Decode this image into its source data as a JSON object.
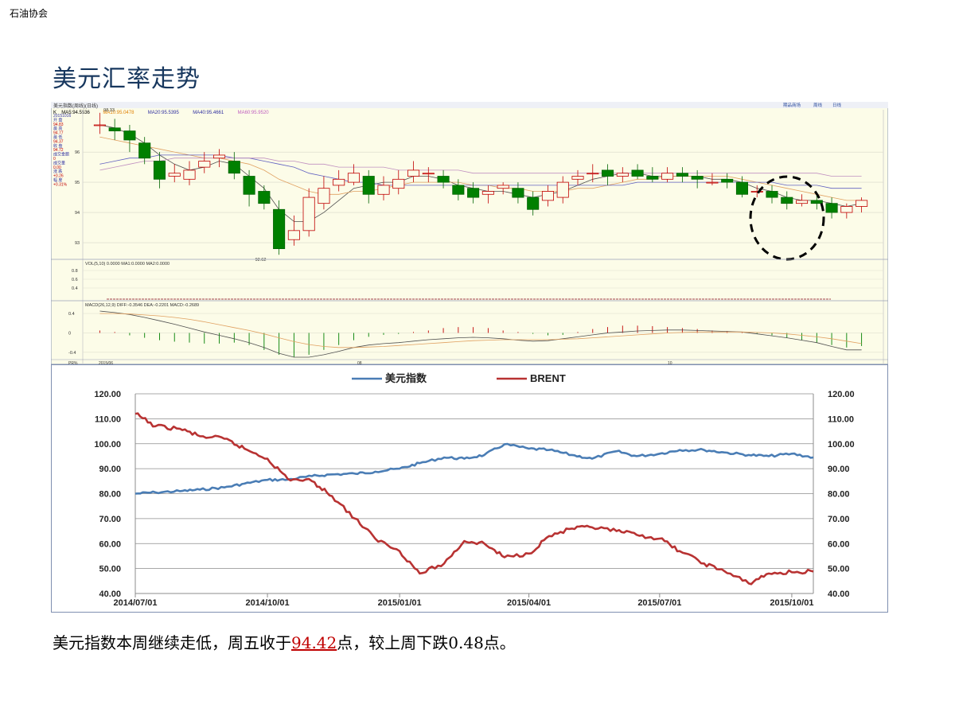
{
  "header": {
    "org": "石油协会"
  },
  "slide": {
    "title": "美元汇率走势",
    "summary_prefix": "美元指数本周继续走低，周五收于",
    "summary_value": "94.42",
    "summary_suffix": "点，较上周下跌0.48点。"
  },
  "kline": {
    "header_text": "美元指数(周线)(日线)",
    "ma_labels": [
      {
        "text": "K",
        "color": "#000000"
      },
      {
        "text": "MA5:94.5536",
        "color": "#000000"
      },
      {
        "text": "MA10:95.0478",
        "color": "#e08000"
      },
      {
        "text": "MA20:95.5395",
        "color": "#3030a0"
      },
      {
        "text": "MA40:95.4661",
        "color": "#3030a0"
      },
      {
        "text": "MA60:95.9520",
        "color": "#c060c0"
      }
    ],
    "top_right_buttons": [
      "期品商场",
      "周线",
      "日线"
    ],
    "sidebar": [
      "20151016",
      "开 盘",
      "94.83",
      "最 高",
      "94.77",
      "最 低",
      "94.37",
      "收 盘",
      "94.72",
      "成交金额",
      "0",
      "成交量",
      "0.00",
      "涨 跌",
      "+0.26",
      "幅 度",
      "+0.31%"
    ],
    "ylabels": [
      "96",
      "95",
      "94",
      "93"
    ],
    "high_label": "98.33",
    "low_label": "92.62",
    "vol_header": "VOL(5,10) 0.0000 MA1:0.0000 MA2:0.0000",
    "vol_ylabels": [
      "0.8",
      "0.6",
      "0.4"
    ],
    "macd_header": "MACD(26,12,9) DIFF:-0.3546 DEA:-0.2201 MACD:-0.2689",
    "macd_ylabels": [
      "0.4",
      "0",
      "-0.4"
    ],
    "bottom_labels": [
      "PR%",
      "2015/06",
      "08",
      "10"
    ],
    "candles": [
      [
        96.9,
        96.9,
        97.3,
        96.6
      ],
      [
        96.8,
        96.7,
        97.1,
        96.4
      ],
      [
        96.7,
        96.4,
        96.9,
        96.0
      ],
      [
        96.3,
        95.8,
        96.5,
        95.6
      ],
      [
        95.7,
        95.1,
        96.0,
        94.8
      ],
      [
        95.2,
        95.3,
        95.6,
        95.0
      ],
      [
        95.1,
        95.4,
        95.7,
        94.9
      ],
      [
        95.5,
        95.7,
        96.0,
        95.3
      ],
      [
        95.8,
        95.9,
        96.1,
        95.5
      ],
      [
        95.7,
        95.3,
        96.0,
        95.1
      ],
      [
        95.2,
        94.6,
        95.4,
        94.2
      ],
      [
        94.7,
        94.3,
        94.9,
        94.1
      ],
      [
        94.1,
        92.8,
        94.4,
        92.6
      ],
      [
        93.1,
        93.4,
        93.9,
        92.9
      ],
      [
        93.4,
        94.5,
        94.8,
        93.2
      ],
      [
        94.3,
        94.8,
        95.2,
        94.1
      ],
      [
        94.9,
        95.1,
        95.4,
        94.7
      ],
      [
        95.0,
        95.3,
        95.6,
        94.9
      ],
      [
        95.2,
        94.6,
        95.4,
        94.3
      ],
      [
        94.6,
        94.9,
        95.2,
        94.4
      ],
      [
        94.8,
        95.1,
        95.4,
        94.6
      ],
      [
        95.2,
        95.4,
        95.7,
        95.0
      ],
      [
        95.3,
        95.3,
        95.5,
        95.0
      ],
      [
        95.2,
        95.0,
        95.4,
        94.8
      ],
      [
        94.9,
        94.6,
        95.1,
        94.4
      ],
      [
        94.8,
        94.5,
        95.0,
        94.3
      ],
      [
        94.6,
        94.7,
        94.9,
        94.3
      ],
      [
        94.8,
        94.9,
        95.0,
        94.6
      ],
      [
        94.8,
        94.5,
        95.0,
        94.3
      ],
      [
        94.5,
        94.1,
        94.7,
        93.9
      ],
      [
        94.4,
        94.7,
        94.9,
        94.2
      ],
      [
        94.5,
        95.0,
        95.2,
        94.3
      ],
      [
        95.1,
        95.2,
        95.4,
        94.9
      ],
      [
        95.3,
        95.3,
        95.6,
        95.0
      ],
      [
        95.4,
        95.2,
        95.6,
        94.9
      ],
      [
        95.2,
        95.3,
        95.5,
        95.0
      ],
      [
        95.4,
        95.2,
        95.6,
        95.1
      ],
      [
        95.2,
        95.1,
        95.5,
        95.0
      ],
      [
        95.1,
        95.3,
        95.5,
        95.0
      ],
      [
        95.3,
        95.2,
        95.5,
        95.0
      ],
      [
        95.2,
        95.1,
        95.4,
        94.8
      ],
      [
        95.0,
        95.0,
        95.3,
        94.9
      ],
      [
        95.1,
        95.0,
        95.3,
        94.8
      ],
      [
        95.0,
        94.6,
        95.2,
        94.5
      ],
      [
        94.7,
        94.7,
        94.9,
        94.5
      ],
      [
        94.7,
        94.5,
        94.9,
        94.3
      ],
      [
        94.5,
        94.3,
        94.7,
        94.1
      ],
      [
        94.3,
        94.4,
        94.6,
        94.2
      ],
      [
        94.4,
        94.3,
        94.6,
        94.1
      ],
      [
        94.3,
        94.0,
        94.5,
        93.8
      ],
      [
        94.0,
        94.2,
        94.3,
        93.8
      ],
      [
        94.2,
        94.4,
        94.5,
        94.0
      ]
    ],
    "ma_lines": {
      "ma5": [
        96.9,
        96.8,
        96.6,
        96.3,
        95.9,
        95.6,
        95.4,
        95.5,
        95.7,
        95.6,
        95.2,
        94.8,
        94.1,
        93.7,
        93.7,
        94.0,
        94.4,
        94.8,
        94.9,
        95.0,
        95.0,
        95.2,
        95.2,
        95.1,
        94.9,
        94.8,
        94.7,
        94.7,
        94.6,
        94.5,
        94.6,
        94.7,
        94.9,
        95.1,
        95.2,
        95.3,
        95.3,
        95.2,
        95.2,
        95.2,
        95.2,
        95.1,
        95.1,
        95.0,
        94.8,
        94.7,
        94.5,
        94.4,
        94.4,
        94.3,
        94.2,
        94.3
      ],
      "ma10": [
        96.5,
        96.4,
        96.3,
        96.2,
        96.1,
        96.0,
        95.9,
        95.8,
        95.8,
        95.7,
        95.6,
        95.4,
        95.1,
        94.9,
        94.7,
        94.6,
        94.6,
        94.7,
        94.7,
        94.8,
        94.9,
        95.0,
        95.0,
        95.0,
        95.0,
        94.9,
        94.9,
        94.8,
        94.8,
        94.7,
        94.7,
        94.7,
        94.8,
        94.8,
        94.9,
        95.0,
        95.1,
        95.1,
        95.2,
        95.2,
        95.2,
        95.2,
        95.2,
        95.1,
        95.0,
        94.9,
        94.8,
        94.7,
        94.6,
        94.5,
        94.4,
        94.4
      ],
      "ma20": [
        95.6,
        95.7,
        95.8,
        95.8,
        95.9,
        95.9,
        95.9,
        95.9,
        95.9,
        95.8,
        95.8,
        95.7,
        95.6,
        95.5,
        95.3,
        95.2,
        95.1,
        95.0,
        95.0,
        94.9,
        94.9,
        94.9,
        94.9,
        94.9,
        94.9,
        94.9,
        94.9,
        94.9,
        94.9,
        94.9,
        94.9,
        94.9,
        94.9,
        94.9,
        94.9,
        94.9,
        95.0,
        95.0,
        95.0,
        95.0,
        95.0,
        95.0,
        95.0,
        95.0,
        95.0,
        95.0,
        94.9,
        94.9,
        94.9,
        94.8,
        94.8,
        94.8
      ],
      "ma60": [
        95.4,
        95.5,
        95.6,
        95.7,
        95.7,
        95.8,
        95.8,
        95.8,
        95.8,
        95.8,
        95.8,
        95.8,
        95.7,
        95.7,
        95.6,
        95.6,
        95.5,
        95.5,
        95.5,
        95.5,
        95.4,
        95.4,
        95.4,
        95.4,
        95.4,
        95.3,
        95.3,
        95.3,
        95.3,
        95.3,
        95.3,
        95.3,
        95.3,
        95.3,
        95.3,
        95.3,
        95.3,
        95.3,
        95.3,
        95.3,
        95.3,
        95.3,
        95.3,
        95.3,
        95.3,
        95.3,
        95.3,
        95.3,
        95.3,
        95.2,
        95.2,
        95.2
      ]
    },
    "macd_bars": [
      0.05,
      0.02,
      -0.05,
      -0.1,
      -0.15,
      -0.18,
      -0.2,
      -0.22,
      -0.22,
      -0.2,
      -0.25,
      -0.35,
      -0.45,
      -0.5,
      -0.45,
      -0.35,
      -0.25,
      -0.15,
      -0.08,
      -0.04,
      -0.02,
      0.02,
      0.05,
      0.1,
      0.12,
      0.12,
      0.1,
      0.05,
      0.02,
      -0.02,
      -0.05,
      -0.04,
      0.02,
      0.08,
      0.12,
      0.15,
      0.15,
      0.14,
      0.12,
      0.1,
      0.08,
      0.05,
      0.04,
      0.02,
      -0.02,
      -0.05,
      -0.1,
      -0.15,
      -0.2,
      -0.25,
      -0.3,
      -0.27
    ],
    "diff": [
      0.45,
      0.42,
      0.38,
      0.32,
      0.25,
      0.18,
      0.1,
      0.02,
      -0.05,
      -0.12,
      -0.2,
      -0.3,
      -0.42,
      -0.5,
      -0.5,
      -0.45,
      -0.38,
      -0.3,
      -0.25,
      -0.22,
      -0.2,
      -0.17,
      -0.14,
      -0.12,
      -0.1,
      -0.09,
      -0.1,
      -0.12,
      -0.15,
      -0.17,
      -0.16,
      -0.12,
      -0.08,
      -0.04,
      0.0,
      0.02,
      0.04,
      0.05,
      0.06,
      0.06,
      0.05,
      0.04,
      0.03,
      0.02,
      -0.02,
      -0.06,
      -0.1,
      -0.15,
      -0.2,
      -0.28,
      -0.35,
      -0.35
    ],
    "dea": [
      0.4,
      0.4,
      0.39,
      0.37,
      0.35,
      0.32,
      0.28,
      0.23,
      0.17,
      0.11,
      0.05,
      -0.02,
      -0.1,
      -0.18,
      -0.24,
      -0.28,
      -0.3,
      -0.3,
      -0.29,
      -0.28,
      -0.26,
      -0.24,
      -0.22,
      -0.2,
      -0.18,
      -0.16,
      -0.15,
      -0.14,
      -0.14,
      -0.14,
      -0.14,
      -0.13,
      -0.12,
      -0.1,
      -0.08,
      -0.06,
      -0.04,
      -0.02,
      0.0,
      0.01,
      0.02,
      0.02,
      0.02,
      0.02,
      0.01,
      0.0,
      -0.02,
      -0.05,
      -0.08,
      -0.12,
      -0.17,
      -0.22
    ],
    "circle_label": ""
  },
  "chart_data": {
    "type": "line",
    "title": "",
    "legend": [
      "美元指数",
      "BRENT"
    ],
    "legend_position": "top",
    "xlabel": "",
    "ylabel": "",
    "ylim": [
      40,
      120
    ],
    "yticks": [
      "40.00",
      "50.00",
      "60.00",
      "70.00",
      "80.00",
      "90.00",
      "100.00",
      "110.00",
      "120.00"
    ],
    "xticks": [
      "2014/07/01",
      "2014/10/01",
      "2015/01/01",
      "2015/04/01",
      "2015/07/01",
      "2015/10/01"
    ],
    "x_range": [
      "2014/07/01",
      "2015/10/16"
    ],
    "grid": true,
    "series": [
      {
        "name": "美元指数",
        "color": "#4a7db5",
        "points": [
          [
            "2014/07/01",
            80.0
          ],
          [
            "2014/07/15",
            80.5
          ],
          [
            "2014/08/01",
            81.0
          ],
          [
            "2014/08/15",
            81.6
          ],
          [
            "2014/09/01",
            82.5
          ],
          [
            "2014/09/15",
            84.0
          ],
          [
            "2014/10/01",
            85.5
          ],
          [
            "2014/10/15",
            85.6
          ],
          [
            "2014/11/01",
            87.0
          ],
          [
            "2014/11/15",
            87.7
          ],
          [
            "2014/12/01",
            88.0
          ],
          [
            "2014/12/15",
            88.8
          ],
          [
            "2015/01/01",
            90.0
          ],
          [
            "2015/01/15",
            92.2
          ],
          [
            "2015/02/01",
            94.5
          ],
          [
            "2015/02/15",
            94.0
          ],
          [
            "2015/03/01",
            95.5
          ],
          [
            "2015/03/15",
            99.8
          ],
          [
            "2015/04/01",
            98.0
          ],
          [
            "2015/04/15",
            97.5
          ],
          [
            "2015/05/01",
            95.5
          ],
          [
            "2015/05/15",
            94.0
          ],
          [
            "2015/06/01",
            97.0
          ],
          [
            "2015/06/15",
            95.0
          ],
          [
            "2015/07/01",
            96.0
          ],
          [
            "2015/07/15",
            97.5
          ],
          [
            "2015/08/01",
            97.5
          ],
          [
            "2015/08/15",
            96.5
          ],
          [
            "2015/09/01",
            95.5
          ],
          [
            "2015/09/15",
            95.0
          ],
          [
            "2015/10/01",
            96.0
          ],
          [
            "2015/10/16",
            94.5
          ]
        ]
      },
      {
        "name": "BRENT",
        "color": "#b83232",
        "points": [
          [
            "2014/07/01",
            112.0
          ],
          [
            "2014/07/15",
            107.0
          ],
          [
            "2014/08/01",
            106.0
          ],
          [
            "2014/08/15",
            103.0
          ],
          [
            "2014/09/01",
            102.0
          ],
          [
            "2014/09/15",
            98.0
          ],
          [
            "2014/10/01",
            94.0
          ],
          [
            "2014/10/15",
            86.0
          ],
          [
            "2014/11/01",
            85.0
          ],
          [
            "2014/11/15",
            79.0
          ],
          [
            "2014/12/01",
            70.0
          ],
          [
            "2014/12/15",
            62.0
          ],
          [
            "2015/01/01",
            57.0
          ],
          [
            "2015/01/15",
            48.0
          ],
          [
            "2015/02/01",
            52.0
          ],
          [
            "2015/02/15",
            61.0
          ],
          [
            "2015/03/01",
            60.0
          ],
          [
            "2015/03/15",
            54.5
          ],
          [
            "2015/04/01",
            56.0
          ],
          [
            "2015/04/15",
            63.0
          ],
          [
            "2015/05/01",
            66.0
          ],
          [
            "2015/05/15",
            66.5
          ],
          [
            "2015/06/01",
            65.0
          ],
          [
            "2015/06/15",
            63.5
          ],
          [
            "2015/07/01",
            62.0
          ],
          [
            "2015/07/15",
            57.0
          ],
          [
            "2015/08/01",
            52.0
          ],
          [
            "2015/08/15",
            49.0
          ],
          [
            "2015/09/01",
            44.0
          ],
          [
            "2015/09/15",
            48.0
          ],
          [
            "2015/10/01",
            48.5
          ],
          [
            "2015/10/16",
            48.8
          ]
        ]
      }
    ]
  }
}
